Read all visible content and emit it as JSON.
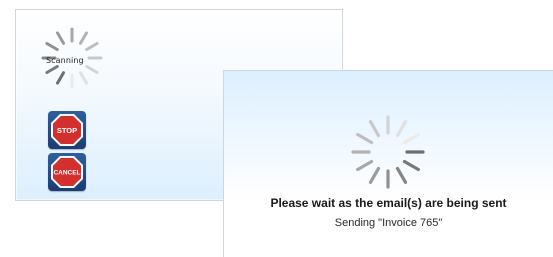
{
  "scanning_dialog": {
    "status_label": "Scanning",
    "stop_button_label": "STOP",
    "cancel_button_label": "CANCEL",
    "spinner_icon": "spinner-icon",
    "stop_icon": "stop-sign-icon",
    "cancel_icon": "cancel-sign-icon",
    "button_colors": {
      "octagon_fill": "#d32f2f",
      "octagon_border": "#ffffff",
      "tile_background": "#2f5f9e"
    }
  },
  "sending_dialog": {
    "title": "Please wait as the email(s) are being sent",
    "subtitle": "Sending \"Invoice 765\"",
    "spinner_icon": "spinner-icon"
  }
}
